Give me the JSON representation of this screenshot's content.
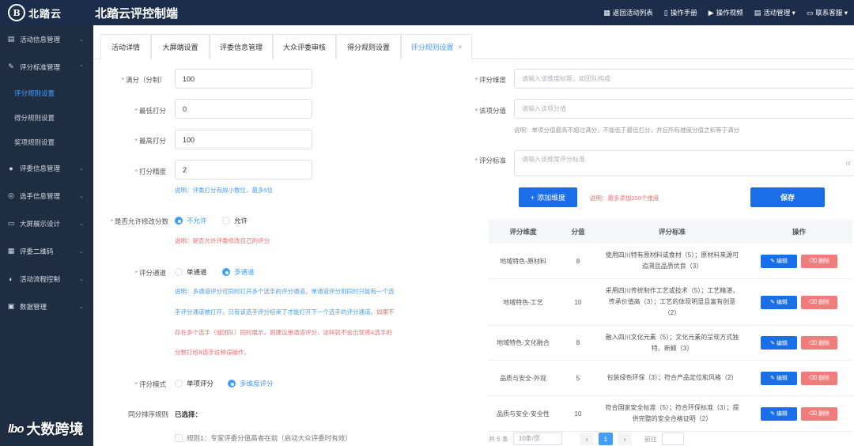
{
  "topbar": {
    "logo_glyph": "B",
    "logo_text": "北踏云",
    "title": "北踏云评控制端",
    "actions": [
      {
        "icon": "grid-icon",
        "glyph": "▦",
        "label": "返回活动列表"
      },
      {
        "icon": "book-icon",
        "glyph": "▯",
        "label": "操作手册"
      },
      {
        "icon": "play-icon",
        "glyph": "▶",
        "label": "操作视频"
      },
      {
        "icon": "calendar-icon",
        "glyph": "▤",
        "label": "活动管理 ▾"
      },
      {
        "icon": "chat-icon",
        "glyph": "▭",
        "label": "联系客服 ▾"
      }
    ]
  },
  "sidebar": {
    "items": [
      {
        "type": "group",
        "icon": "document-icon",
        "glyph": "▤",
        "label": "活动信息管理"
      },
      {
        "type": "group",
        "icon": "edit-icon",
        "glyph": "✎",
        "label": "评分标准管理"
      },
      {
        "type": "sub",
        "label": "评分规则设置",
        "active": true
      },
      {
        "type": "sub",
        "label": "得分规则设置"
      },
      {
        "type": "sub",
        "label": "奖项规则设置"
      },
      {
        "type": "group",
        "icon": "user-icon",
        "glyph": "●",
        "label": "评委信息管理"
      },
      {
        "type": "group",
        "icon": "contestant-icon",
        "glyph": "◎",
        "label": "选手信息管理"
      },
      {
        "type": "group",
        "icon": "monitor-icon",
        "glyph": "▭",
        "label": "大屏展示设计"
      },
      {
        "type": "group",
        "icon": "qrcode-icon",
        "glyph": "▦",
        "label": "评委二维码"
      },
      {
        "type": "group",
        "icon": "flow-icon",
        "glyph": "◐",
        "label": "活动流程控制"
      },
      {
        "type": "group",
        "icon": "data-icon",
        "glyph": "▣",
        "label": "数据管理"
      }
    ]
  },
  "tabs": [
    "活动详情",
    "大屏端设置",
    "评委信息管理",
    "大众评委审核",
    "得分规则设置",
    "评分规则设置"
  ],
  "tab_close": "×",
  "form": {
    "full_score": {
      "label": "满分（分制）",
      "value": "100"
    },
    "min_score": {
      "label": "最低打分",
      "value": "0"
    },
    "max_score": {
      "label": "最高打分",
      "value": "100"
    },
    "precision": {
      "label": "打分精度",
      "value": "2",
      "note": "说明：评委打分有效小数位，最多5位"
    },
    "allow_modify": {
      "label": "是否允许修改分数",
      "options": [
        "不允许",
        "允许"
      ],
      "selected": "不允许",
      "note": "说明：是否允许评委修改自己的评分"
    },
    "channel": {
      "label": "评分通道",
      "options": [
        "单通道",
        "多通道"
      ],
      "selected": "多通道",
      "note_line1": "说明：多通道评分可同时打开多个选手的评分通道。单通道评分则同时只能有一个选",
      "note_line2_blue": "手评分通道被打开，只有该选手评分结束了才能打开下一个选手的评分通道。",
      "note_line2_red": "如果不",
      "note_line3": "存在多个选手（或团队）同时展示，则建议单通道评分，这样就不会出现将A选手的",
      "note_line4": "分数打给B选手这种误操作。"
    },
    "mode": {
      "label": "评分模式",
      "options": [
        "单项评分",
        "多维度评分"
      ],
      "selected": "多维度评分"
    },
    "tie_rule": {
      "label": "同分排序规则",
      "value": "已选择：",
      "partial_line": "规则1：专家评委分值高者在前（启动大众评委时有效）"
    }
  },
  "dimension_form": {
    "dimension": {
      "label": "评分维度",
      "placeholder": "请输入该维度标题，如团队构成"
    },
    "item_score": {
      "label": "该项分值",
      "placeholder": "请输入该项分值",
      "note": "说明：单项分值最高不超过满分，不能低于最低打分，并且所有维度分值之和等于满分"
    },
    "criteria": {
      "label": "评分标准",
      "placeholder": "请输入该维度评分标准",
      "counter": "0/"
    },
    "add_button": "添加维度",
    "add_note": "说明：最多添加200个维度",
    "save_button": "保存"
  },
  "table": {
    "headers": [
      "评分维度",
      "分值",
      "评分标准",
      "操作"
    ],
    "rows": [
      {
        "dimension": "地域特色-原材料",
        "score": "8",
        "criteria": "使用四川特有原材料或食材（5）；原材料来源可追溯且品质优良（3）"
      },
      {
        "dimension": "地域特色-工艺",
        "score": "10",
        "criteria": "采用四川传统制作工艺或技术（5）；工艺精湛，传承价值高（3）；工艺的体现明显且富有创意（2）"
      },
      {
        "dimension": "地域特色-文化融合",
        "score": "8",
        "criteria": "融入四川文化元素（5）；文化元素的呈现方式独特、新颖（3）"
      },
      {
        "dimension": "品质与安全-外观",
        "score": "5",
        "criteria": "包装绿色环保（3）；符合产品定位和风格（2）"
      },
      {
        "dimension": "品质与安全-安全性",
        "score": "10",
        "criteria": "符合国家安全标准（5）；符合环保标准（3）；提供完整的安全合格证明（2）"
      }
    ],
    "edit_label": "编辑",
    "delete_label": "删除"
  },
  "pager": {
    "total": "共 5 条",
    "size": "10条/页",
    "current": "1",
    "goto": "前往"
  },
  "watermark": {
    "logo": "lbo",
    "text": "大数跨境"
  }
}
